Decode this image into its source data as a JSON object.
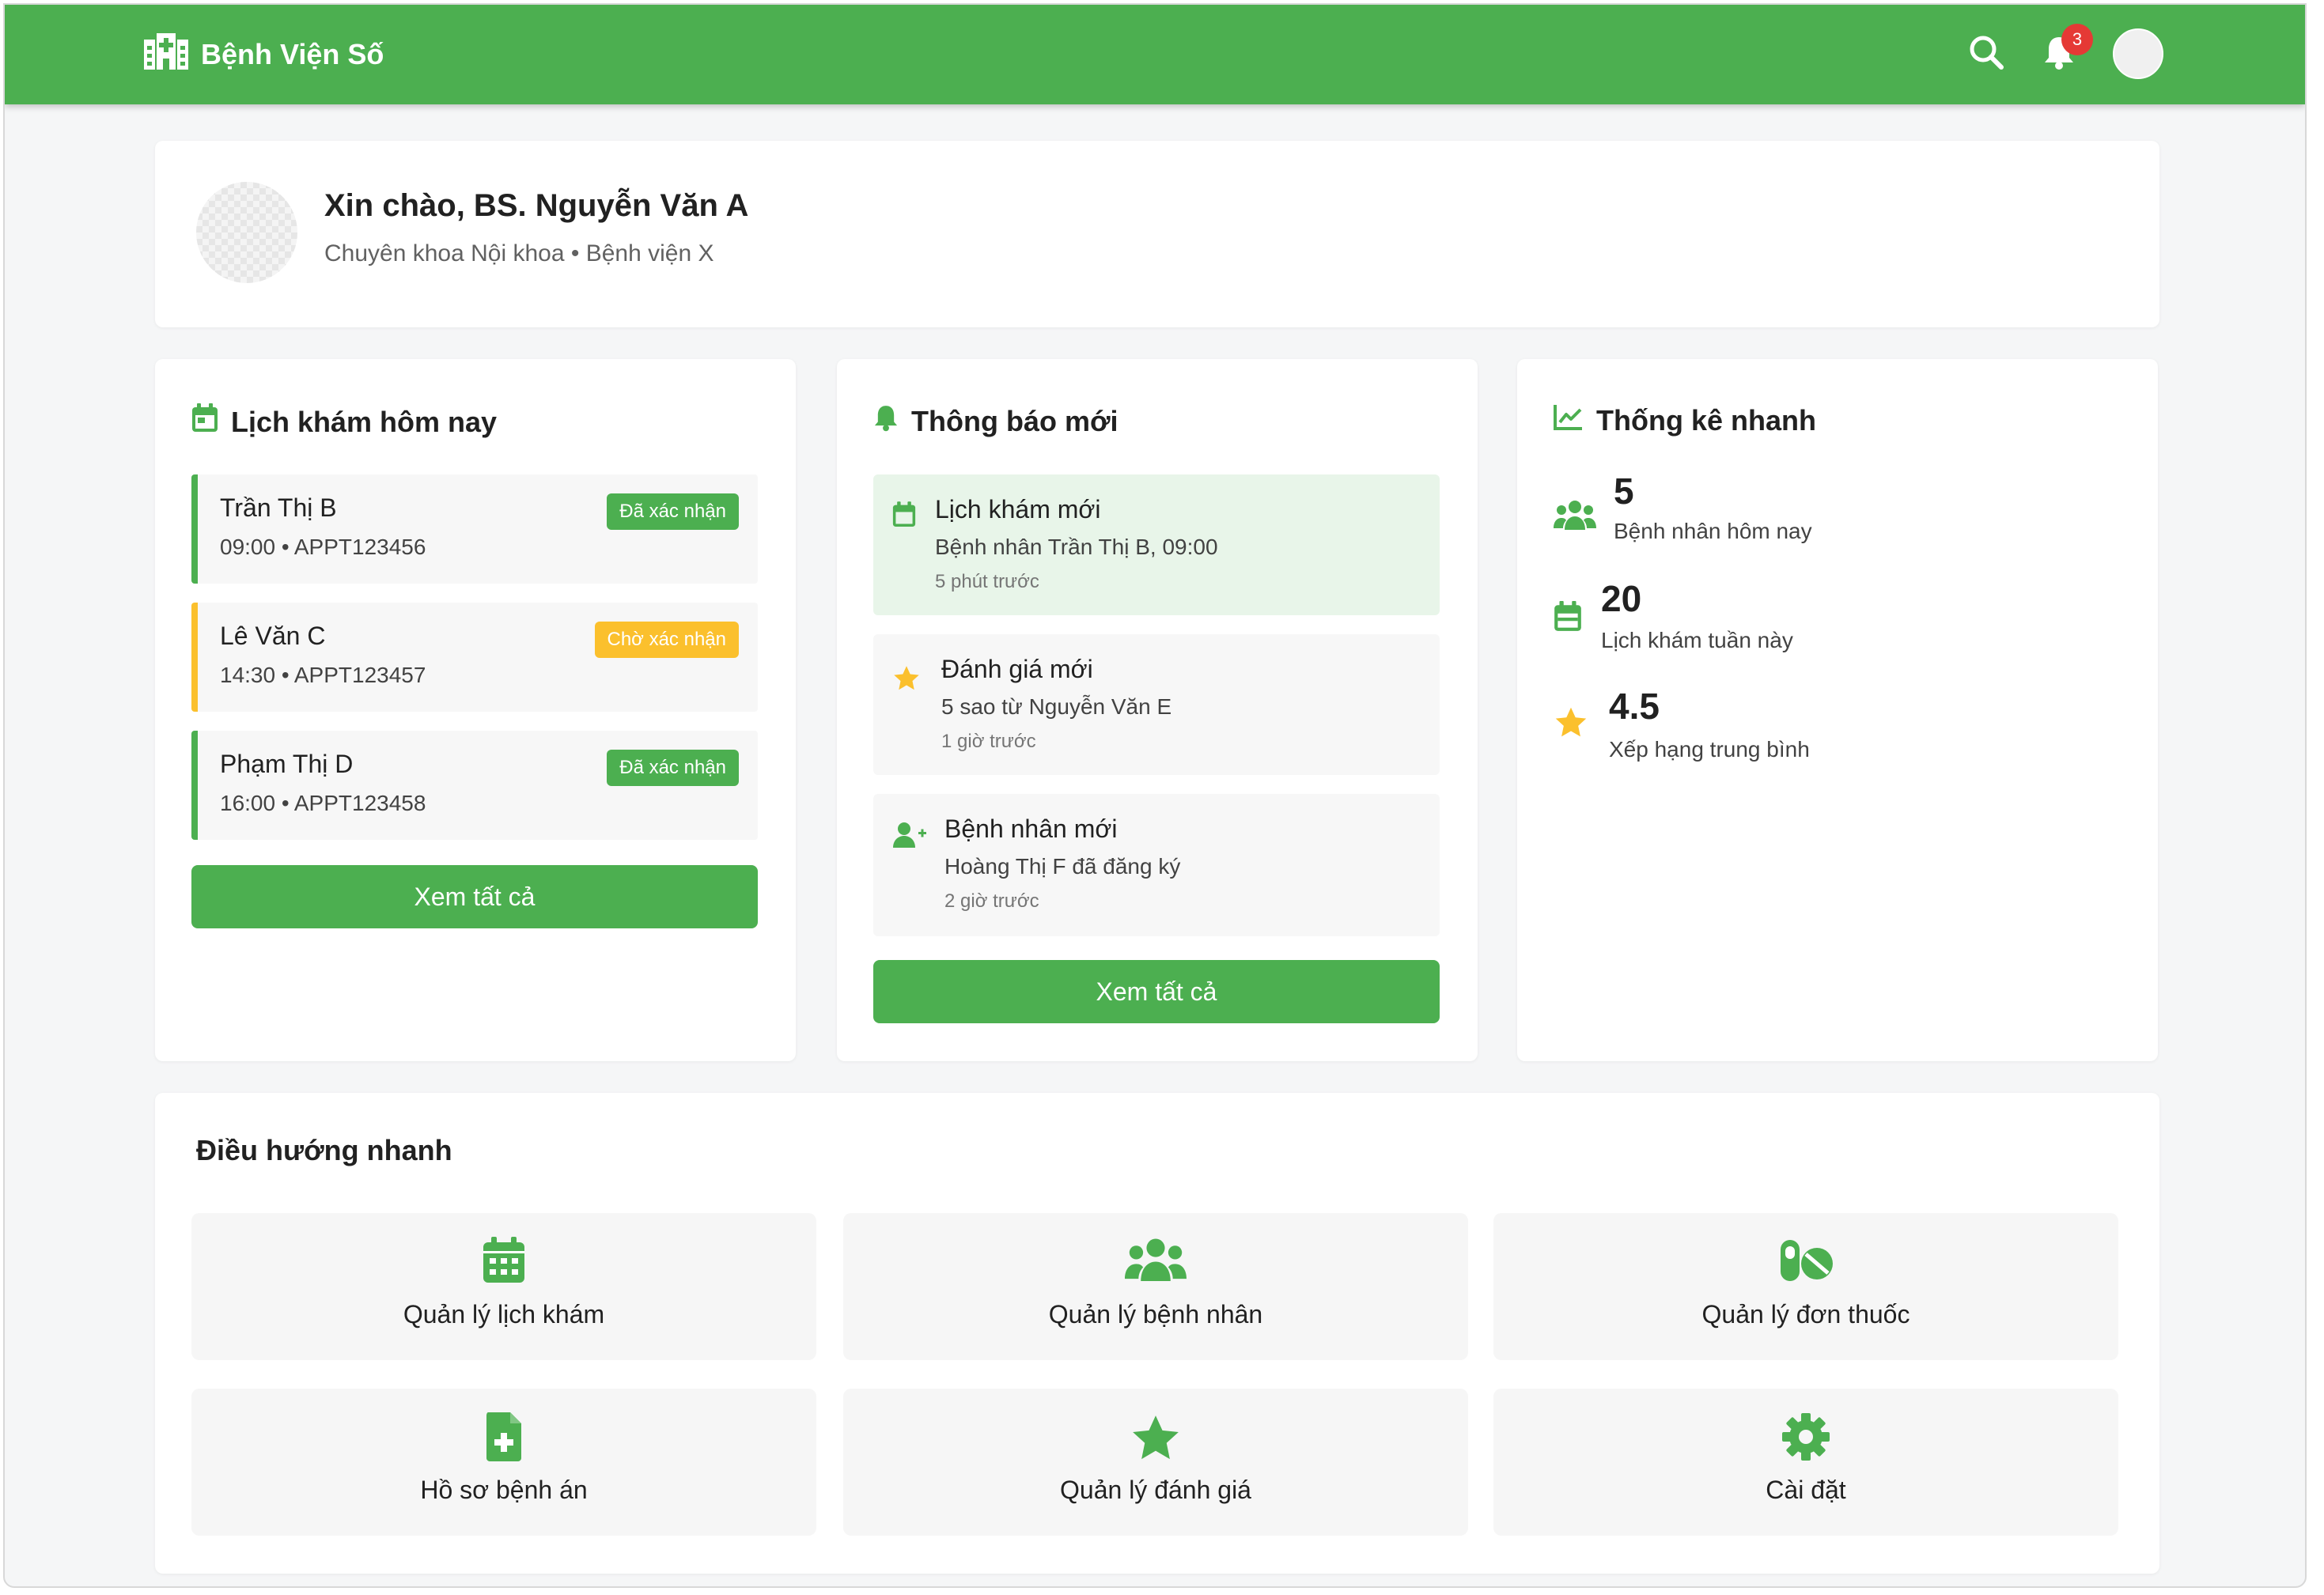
{
  "colors": {
    "primary": "#4caf50",
    "header_bg": "#4caf50",
    "confirmed": "#4caf50",
    "pending": "#fbc02d",
    "star": "#fbc02d",
    "badge": "#e53935",
    "notification_highlight": "#e8f5e9"
  },
  "header": {
    "brand": "Bệnh Viện Số",
    "brand_icon": "hospital-icon",
    "search_icon": "search-icon",
    "bell_icon": "bell-icon",
    "notification_count": "3",
    "avatar": "avatar"
  },
  "welcome": {
    "title": "Xin chào, BS. Nguyễn Văn A",
    "subtitle": "Chuyên khoa Nội khoa • Bệnh viện X"
  },
  "appointments": {
    "title": "Lịch khám hôm nay",
    "icon": "calendar-icon",
    "items": [
      {
        "name": "Trần Thị B",
        "meta": "09:00 • APPT123456",
        "status": "Đã xác nhận",
        "state": "confirmed"
      },
      {
        "name": "Lê Văn C",
        "meta": "14:30 • APPT123457",
        "status": "Chờ xác nhận",
        "state": "pending"
      },
      {
        "name": "Phạm Thị D",
        "meta": "16:00 • APPT123458",
        "status": "Đã xác nhận",
        "state": "confirmed"
      }
    ],
    "view_all": "Xem tất cả"
  },
  "notifications": {
    "title": "Thông báo mới",
    "icon": "bell-icon",
    "items": [
      {
        "icon": "calendar-icon",
        "title": "Lịch khám mới",
        "desc": "Bệnh nhân Trần Thị B, 09:00",
        "time": "5 phút trước",
        "highlight": true
      },
      {
        "icon": "star-icon",
        "title": "Đánh giá mới",
        "desc": "5 sao từ Nguyễn Văn E",
        "time": "1 giờ trước",
        "highlight": false
      },
      {
        "icon": "user-plus-icon",
        "title": "Bệnh nhân mới",
        "desc": "Hoàng Thị F đã đăng ký",
        "time": "2 giờ trước",
        "highlight": false
      }
    ],
    "view_all": "Xem tất cả"
  },
  "stats": {
    "title": "Thống kê nhanh",
    "icon": "chart-line-icon",
    "items": [
      {
        "icon": "users-icon",
        "value": "5",
        "label": "Bệnh nhân hôm nay"
      },
      {
        "icon": "calendar-icon",
        "value": "20",
        "label": "Lịch khám tuần này"
      },
      {
        "icon": "star-icon",
        "value": "4.5",
        "label": "Xếp hạng trung bình"
      }
    ]
  },
  "quick_nav": {
    "title": "Điều hướng nhanh",
    "items": [
      {
        "icon": "calendar-grid-icon",
        "label": "Quản lý lịch khám"
      },
      {
        "icon": "users-icon",
        "label": "Quản lý bệnh nhân"
      },
      {
        "icon": "pills-icon",
        "label": "Quản lý đơn thuốc"
      },
      {
        "icon": "file-medical-icon",
        "label": "Hồ sơ bệnh án"
      },
      {
        "icon": "star-icon",
        "label": "Quản lý đánh giá"
      },
      {
        "icon": "gear-icon",
        "label": "Cài đặt"
      }
    ]
  }
}
